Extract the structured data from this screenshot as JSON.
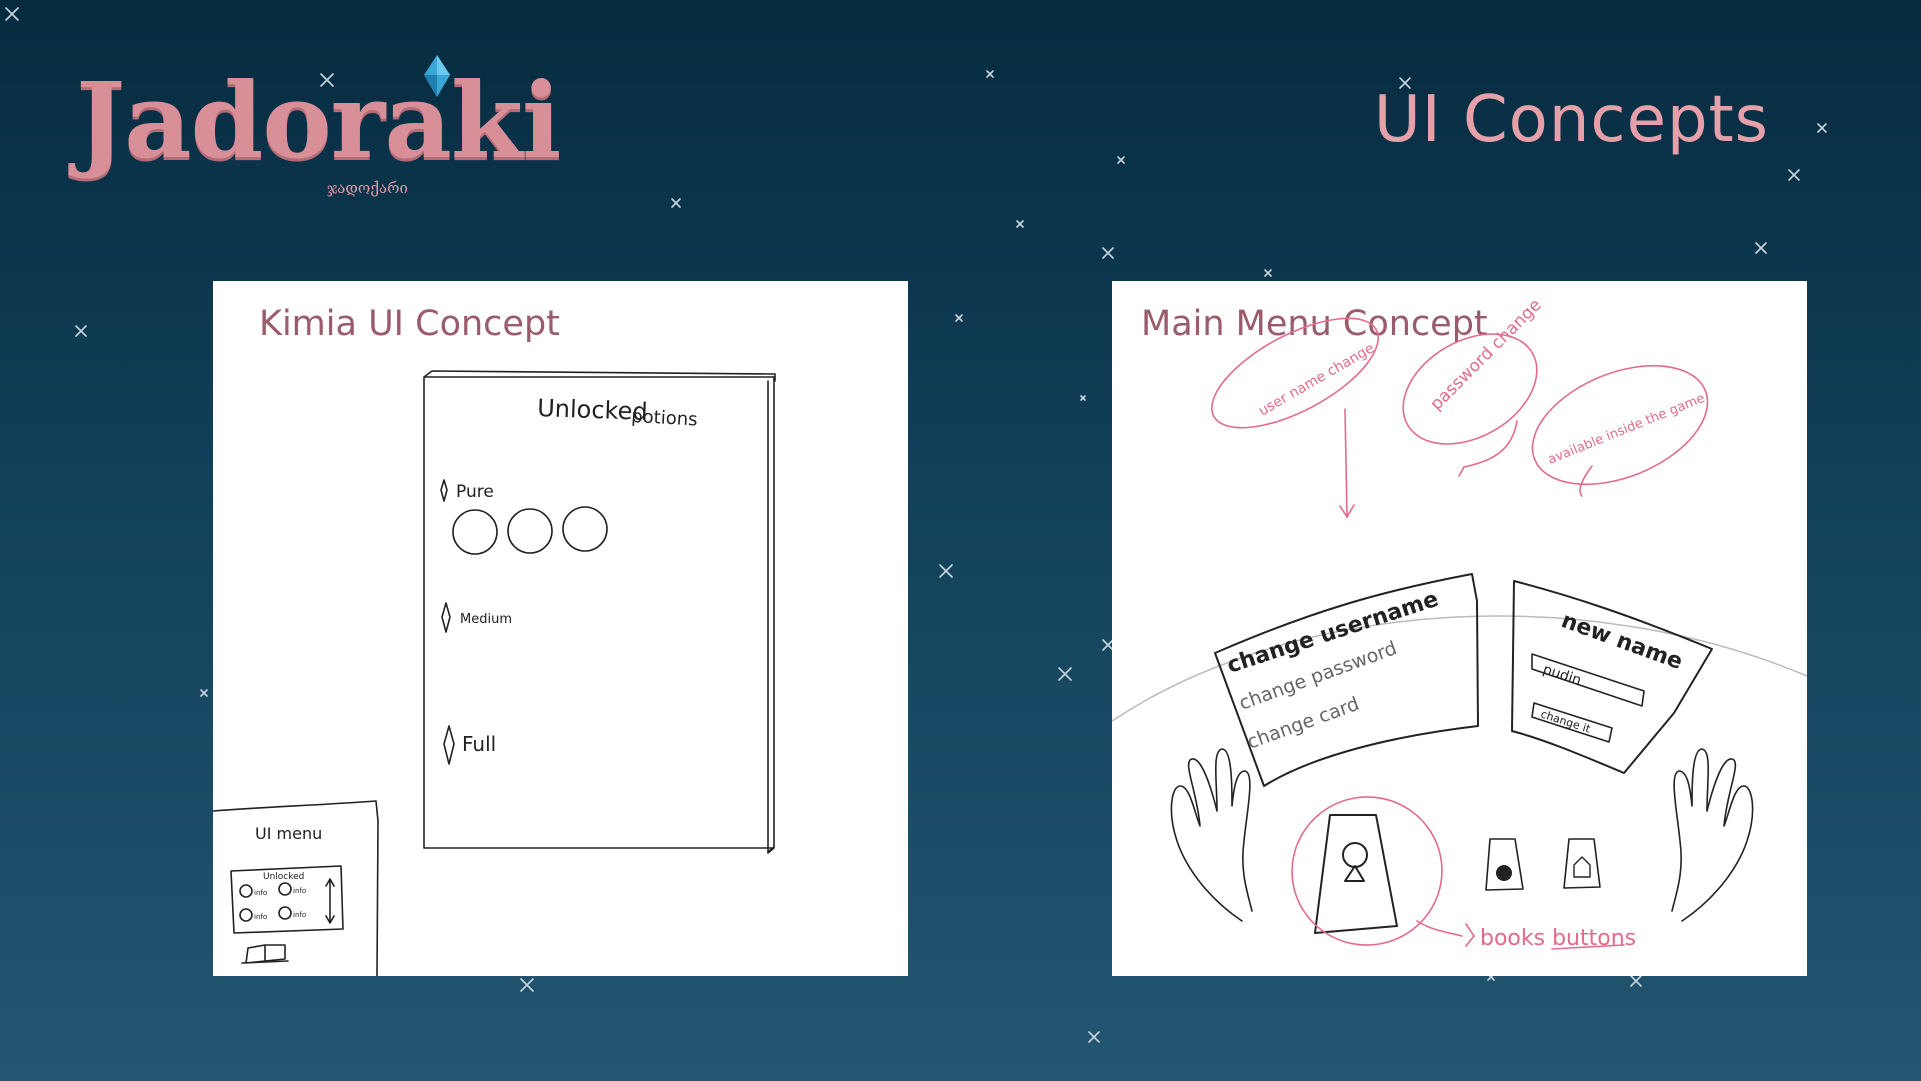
{
  "logo": {
    "wordmark": "Jadoraki",
    "subtitle": "ჯადოქარი"
  },
  "page_title": "UI Concepts",
  "panels": {
    "left": {
      "title": "Kimia UI Concept",
      "sketch": {
        "book_heading": [
          "Unlocked",
          "potions"
        ],
        "sections": [
          "Pure",
          "Medium",
          "Full"
        ],
        "menu_label": "UI menu",
        "mini_heading": "Unlocked",
        "mini_info": "info"
      }
    },
    "right": {
      "title": "Main Menu Concept",
      "sketch": {
        "menu_items": [
          "change username",
          "change password",
          "change card"
        ],
        "new_name_heading": "new name",
        "name_value": "pudin",
        "change_button": "change it",
        "notes": [
          "user name change",
          "password change",
          "available inside the game",
          "books buttons"
        ]
      }
    }
  },
  "colors": {
    "accent_pink": "#e6a0aa",
    "sketch_pink": "#e36b8a",
    "panel_title": "#9a5c6b"
  }
}
